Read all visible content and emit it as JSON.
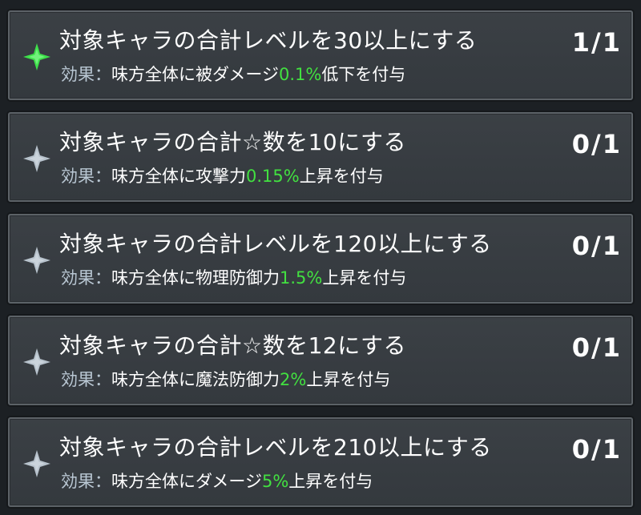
{
  "missions": [
    {
      "title": "対象キャラの合計レベルを30以上にする",
      "effect_label": "効果：",
      "effect_prefix": "味方全体に被ダメージ",
      "effect_value": "0.1%",
      "effect_suffix": "低下を付与",
      "progress": "1/1",
      "completed": true,
      "star_icon": "star-icon-completed"
    },
    {
      "title": "対象キャラの合計☆数を10にする",
      "effect_label": "効果：",
      "effect_prefix": "味方全体に攻撃力",
      "effect_value": "0.15%",
      "effect_suffix": "上昇を付与",
      "progress": "0/1",
      "completed": false,
      "star_icon": "star-icon-incomplete"
    },
    {
      "title": "対象キャラの合計レベルを120以上にする",
      "effect_label": "効果：",
      "effect_prefix": "味方全体に物理防御力",
      "effect_value": "1.5%",
      "effect_suffix": "上昇を付与",
      "progress": "0/1",
      "completed": false,
      "star_icon": "star-icon-incomplete"
    },
    {
      "title": "対象キャラの合計☆数を12にする",
      "effect_label": "効果：",
      "effect_prefix": "味方全体に魔法防御力",
      "effect_value": "2%",
      "effect_suffix": "上昇を付与",
      "progress": "0/1",
      "completed": false,
      "star_icon": "star-icon-incomplete"
    },
    {
      "title": "対象キャラの合計レベルを210以上にする",
      "effect_label": "効果：",
      "effect_prefix": "味方全体にダメージ",
      "effect_value": "5%",
      "effect_suffix": "上昇を付与",
      "progress": "0/1",
      "completed": false,
      "star_icon": "star-icon-incomplete"
    }
  ],
  "colors": {
    "completed_star": "#3ee04a",
    "incomplete_star": "#b7c2cc",
    "effect_value": "#42e040",
    "effect_label": "#b9c7d3"
  }
}
